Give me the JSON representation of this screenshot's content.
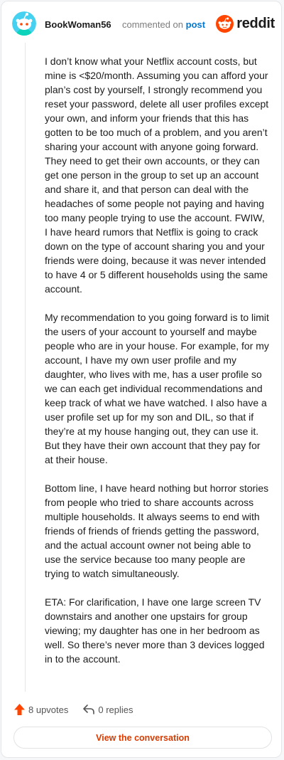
{
  "comment": {
    "username": "BookWoman56",
    "action_text": "commented on",
    "target_link": "post",
    "paragraphs": [
      "I don’t know what your Netflix account costs, but mine is <$20/month. Assuming you can afford your plan’s cost by yourself, I strongly recommend you reset your password, delete all user profiles except your own, and inform your friends that this has gotten to be too much of a problem, and you aren’t sharing your account with anyone going forward. They need to get their own accounts, or they can get one person in the group to set up an account and share it, and that person can deal with the headaches of some people not paying and having too many people trying to use the account. FWIW, I have heard rumors that Netflix is going to crack down on the type of account sharing you and your friends were doing, because it was never intended to have 4 or 5 different households using the same account.",
      "My recommendation to you going forward is to limit the users of your account to yourself and maybe people who are in your house. For example, for my account, I have my own user profile and my daughter, who lives with me, has a user profile so we can each get individual recommendations and keep track of what we have watched. I also have a user profile set up for my son and DIL, so that if they’re at my house hanging out, they can use it. But they have their own account that they pay for at their house.",
      "Bottom line, I have heard nothing but horror stories from people who tried to share accounts across multiple households. It always seems to end with friends of friends of friends getting the password, and the actual account owner not being able to use the service because too many people are trying to watch simultaneously.",
      "ETA: For clarification, I have one large screen TV downstairs and another one upstairs for group viewing; my daughter has one in her bedroom as well. So there’s never more than 3 devices logged in to the account."
    ],
    "upvotes_label": "8 upvotes",
    "replies_label": "0 replies"
  },
  "brand": {
    "wordmark": "reddit",
    "color": "#ff4500"
  },
  "footer": {
    "view_conversation_label": "View the conversation"
  },
  "icons": {
    "avatar": "snoo-avatar-icon",
    "brand": "reddit-logo-icon",
    "upvote": "upvote-arrow-icon",
    "reply": "reply-arrow-icon"
  },
  "colors": {
    "link": "#0079d3",
    "accent": "#d93a00",
    "avatar_bg": "#46d1f0"
  }
}
